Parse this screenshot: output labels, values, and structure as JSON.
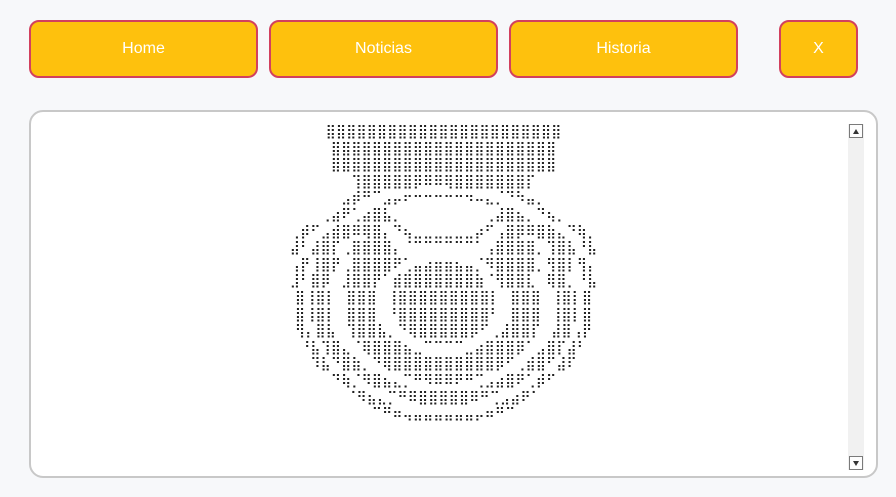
{
  "nav": {
    "home_label": "Home",
    "news_label": "Noticias",
    "history_label": "Historia",
    "close_label": "X"
  },
  "colors": {
    "button_fill": "#fec10d",
    "button_border": "#d2405e",
    "button_text": "#ffffff",
    "panel_border": "#c8c8c8"
  },
  "content": {
    "art": "⣿⣿⣿⣿⣿⣿⣿⣿⣿⣿⣿⣿⣿⣿⣿⣿⣿⣿⣿⣿⣿⣿⣿\n⣿⣿⣿⣿⣿⣿⣿⣿⣿⣿⣿⣿⣿⣿⣿⣿⣿⣿⣿⣿⣿⣿\n⣿⣿⣿⣿⣿⣿⣿⣿⣿⣿⣿⣿⣿⣿⣿⣿⣿⣿⣿⣿⣿⣿\n⢹⣿⣿⣿⣿⣿⡿⠿⠿⢿⣿⣿⣿⣿⣿⣿⣿⡏\n⣠⡾⠛⠉⣠⡤⠖⠒⠒⠒⠒⠒⠲⠤⣄⡈⠙⠳⣤⡀\n⢀⣴⠟⢁⣴⣿⣧⡀⠀⠀⠀⠀⠀⠀⠀⠀⢀⣼⣿⣦⡀⠙⢦⡀\n⢀⡾⠋⣠⣾⣿⠿⢿⣿⡄⠙⢦⣀⣀⣀⣀⣀⣀⡴⠋⢠⣿⡿⠿⣿⣷⣄⠙⢷⡀\n⣼⠃⣼⣿⡏⢀⣿⣿⣿⣿⡄⠈⠉⠉⠉⠉⠉⠉⠁⢠⣿⣿⣿⣿⡀⢹⣿⣧⠘⣧\n⢠⡟⢸⣿⡟⢀⣿⣿⣿⣿⠟⢁⣤⣴⣶⣶⣦⣤⡈⠻⣿⣿⣿⣿⡀⢻⣿⡇⢻⡄\n⣸⠃⣿⡿⠀⣸⣿⣿⡟⠁⣾⣿⣿⣿⣿⣿⣿⣿⣷⠈⢻⣿⣿⣇⠀⢿⣿⡀⠘⣧\n⣿⢸⣿⡇⠀⣿⣿⣿⠀⢸⣿⣿⣿⣿⣿⣿⣿⣿⣿⡇⠀⣿⣿⣿⠀⢸⣿⡇⣿\n⣿⢸⣿⡇⠀⣿⣿⣿⠀⠘⣿⣿⣿⣿⣿⣿⣿⣿⣿⠃⠀⣿⣿⣿⠀⢸⣿⡇⣿\n⢻⡄⣿⣧⠀⢹⣿⣿⣧⡀⠙⢿⣿⣿⣿⣿⣿⡿⠋⢀⣼⣿⣿⡏⠀⣼⣿⢠⡟\n⠘⣧⢹⣿⣄⠈⢿⣿⣿⣿⣦⣀⠉⠉⠉⠉⣀⣴⣿⣿⣿⡿⠁⣠⣿⡏⣼⠃\n⠹⣧⠙⣿⣷⡀⠙⢿⣿⣿⣿⣿⣿⣿⣿⣿⣿⣿⡿⠋⢀⣾⣿⠋⣼⠏\n⠙⢷⡈⠻⣿⣦⣄⡉⠛⠻⠿⠿⠟⠛⢉⣠⣴⣿⠟⢁⡾⠋\n⠈⠻⣦⣄⡉⠛⠿⣿⣿⣿⣿⣿⠿⠛⢉⣠⣴⠟⠁\n⠉⠛⠶⢤⣤⣤⣤⣤⣤⣤⡤⠶⠛⠉"
  }
}
